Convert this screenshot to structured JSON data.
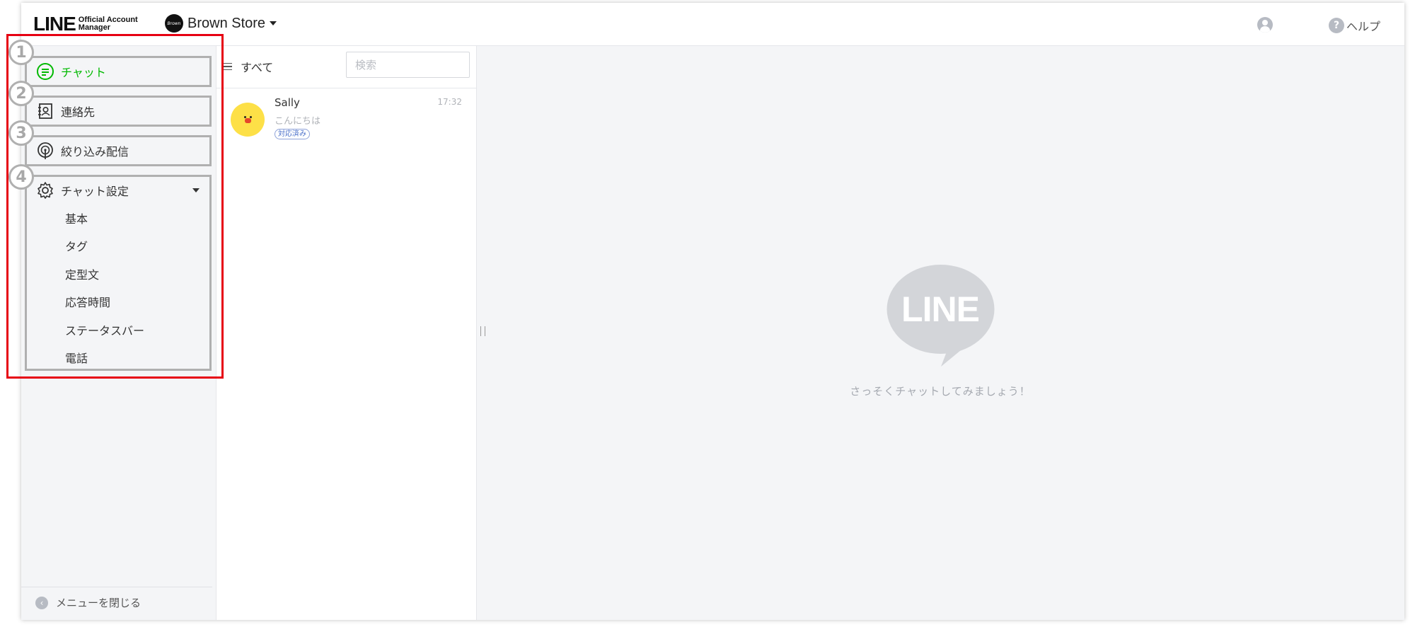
{
  "header": {
    "logo_main": "LINE",
    "logo_sub_line1": "Official Account",
    "logo_sub_line2": "Manager",
    "account_name": "Brown Store",
    "help_label": "ヘルプ"
  },
  "sidebar": {
    "items": [
      {
        "number": "1",
        "label": "チャット",
        "icon": "chat-bubble-icon",
        "active": true
      },
      {
        "number": "2",
        "label": "連絡先",
        "icon": "contact-card-icon",
        "active": false
      },
      {
        "number": "3",
        "label": "絞り込み配信",
        "icon": "broadcast-icon",
        "active": false
      },
      {
        "number": "4",
        "label": "チャット設定",
        "icon": "gear-icon",
        "active": false,
        "subitems": [
          "基本",
          "タグ",
          "定型文",
          "応答時間",
          "ステータスバー",
          "電話"
        ]
      }
    ],
    "close_menu_label": "メニューを閉じる"
  },
  "chat_list": {
    "filter_label": "すべて",
    "search_placeholder": "検索",
    "chats": [
      {
        "name": "Sally",
        "message": "こんにちは",
        "time": "17:32",
        "tag": "対応済み"
      }
    ]
  },
  "main": {
    "logo_text": "LINE",
    "empty_message": "さっそくチャットしてみましょう！"
  },
  "colors": {
    "brand_green": "#00b900",
    "highlight_red": "#e60012",
    "sidebar_bg": "#f4f5f7"
  }
}
